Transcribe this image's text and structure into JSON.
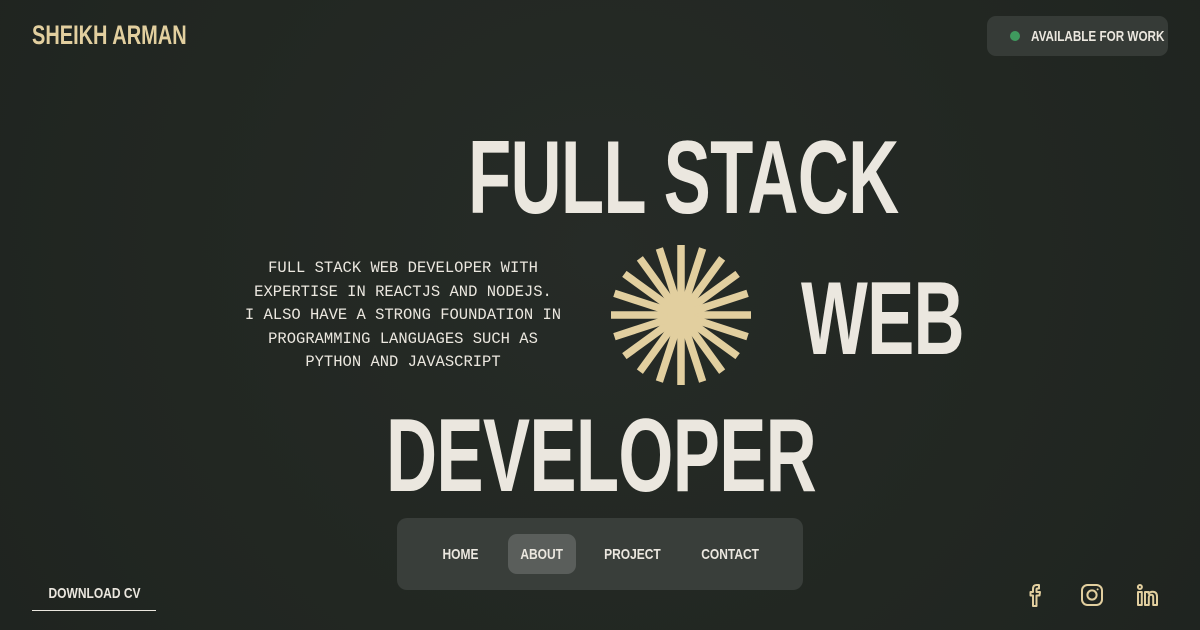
{
  "header": {
    "logo": "SHEIKH ARMAN",
    "status_label": "AVAILABLE FOR WORK",
    "status_color": "#3f9a5e"
  },
  "hero": {
    "line1": "FULL STACK",
    "line2": "WEB",
    "line3": "DEVELOPER",
    "description": "FULL STACK WEB DEVELOPER WITH\nEXPERTISE IN REACTJS AND NODEJS.\nI ALSO HAVE A STRONG FOUNDATION IN\nPROGRAMMING LANGUAGES SUCH AS\nPYTHON AND JAVASCRIPT",
    "accent_color": "#e2cf9f",
    "icon": "sunburst-icon"
  },
  "nav": {
    "items": [
      {
        "label": "HOME",
        "active": false
      },
      {
        "label": "ABOUT",
        "active": true
      },
      {
        "label": "PROJECT",
        "active": false
      },
      {
        "label": "CONTACT",
        "active": false
      }
    ]
  },
  "footer": {
    "download_label": "DOWNLOAD CV",
    "social": [
      "facebook-icon",
      "instagram-icon",
      "linkedin-icon"
    ]
  }
}
